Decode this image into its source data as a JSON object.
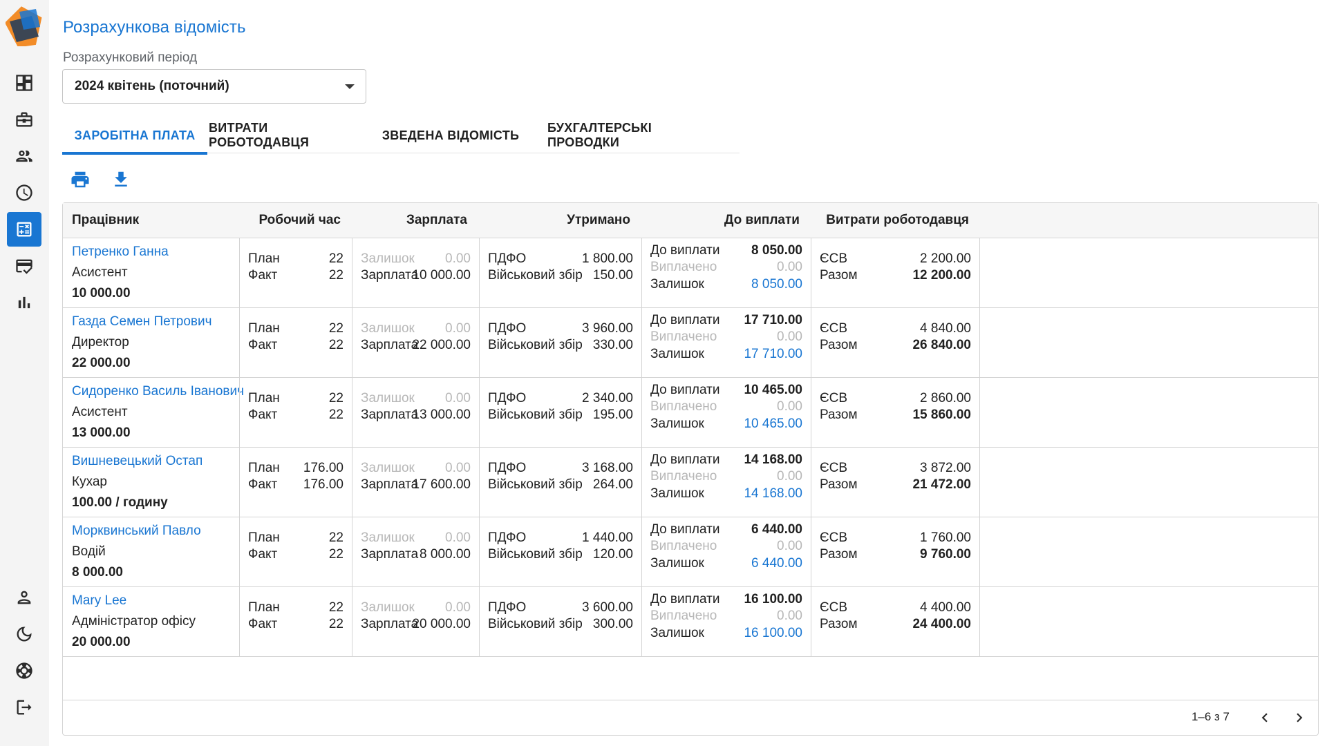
{
  "page": {
    "title": "Розрахункова відомість"
  },
  "period": {
    "label": "Розрахунковий період",
    "value": "2024 квітень (поточний)"
  },
  "sidebar": {
    "items": [
      {
        "icon": "dashboard-icon"
      },
      {
        "icon": "briefcase-icon"
      },
      {
        "icon": "people-icon"
      },
      {
        "icon": "clock-icon"
      },
      {
        "icon": "calculator-icon",
        "active": true
      },
      {
        "icon": "card-check-icon"
      },
      {
        "icon": "bar-chart-icon"
      }
    ],
    "bottom": [
      {
        "icon": "person-icon"
      },
      {
        "icon": "moon-icon"
      },
      {
        "icon": "support-icon"
      },
      {
        "icon": "logout-icon"
      }
    ]
  },
  "tabs": [
    {
      "label": "ЗАРОБІТНА ПЛАТА",
      "active": true
    },
    {
      "label": "ВИТРАТИ РОБОТОДАВЦЯ"
    },
    {
      "label": "ЗВЕДЕНА ВІДОМІСТЬ"
    },
    {
      "label": "БУХГАЛТЕРСЬКІ ПРОВОДКИ"
    }
  ],
  "toolbar": {
    "print_icon": "print-icon",
    "download_icon": "download-icon"
  },
  "table": {
    "headers": {
      "employee": "Працівник",
      "worktime": "Робочий час",
      "salary": "Зарплата",
      "withheld": "Утримано",
      "payout": "До виплати",
      "employer": "Витрати роботодавця"
    },
    "labels": {
      "plan": "План",
      "fact": "Факт",
      "balance": "Залишок",
      "salary": "Зарплата",
      "pdfo": "ПДФО",
      "military": "Військовий збір",
      "to_pay": "До виплати",
      "paid": "Виплачено",
      "remaining": "Залишок",
      "esv": "ЄСВ",
      "total": "Разом"
    },
    "rows": [
      {
        "name": "Петренко Ганна",
        "position": "Асистент",
        "rate": "10 000.00",
        "plan": "22",
        "fact": "22",
        "balance": "0.00",
        "salary": "10 000.00",
        "pdfo": "1 800.00",
        "military": "150.00",
        "to_pay": "8 050.00",
        "paid": "0.00",
        "remaining": "8 050.00",
        "esv": "2 200.00",
        "total": "12 200.00"
      },
      {
        "name": "Газда Семен Петрович",
        "position": "Директор",
        "rate": "22 000.00",
        "plan": "22",
        "fact": "22",
        "balance": "0.00",
        "salary": "22 000.00",
        "pdfo": "3 960.00",
        "military": "330.00",
        "to_pay": "17 710.00",
        "paid": "0.00",
        "remaining": "17 710.00",
        "esv": "4 840.00",
        "total": "26 840.00"
      },
      {
        "name": "Сидоренко Василь Іванович",
        "position": "Асистент",
        "rate": "13 000.00",
        "plan": "22",
        "fact": "22",
        "balance": "0.00",
        "salary": "13 000.00",
        "pdfo": "2 340.00",
        "military": "195.00",
        "to_pay": "10 465.00",
        "paid": "0.00",
        "remaining": "10 465.00",
        "esv": "2 860.00",
        "total": "15 860.00"
      },
      {
        "name": "Вишневецький Остап",
        "position": "Кухар",
        "rate": "100.00 / годину",
        "plan": "176.00",
        "fact": "176.00",
        "balance": "0.00",
        "salary": "17 600.00",
        "pdfo": "3 168.00",
        "military": "264.00",
        "to_pay": "14 168.00",
        "paid": "0.00",
        "remaining": "14 168.00",
        "esv": "3 872.00",
        "total": "21 472.00"
      },
      {
        "name": "Морквинський Павло",
        "position": "Водій",
        "rate": "8 000.00",
        "plan": "22",
        "fact": "22",
        "balance": "0.00",
        "salary": "8 000.00",
        "pdfo": "1 440.00",
        "military": "120.00",
        "to_pay": "6 440.00",
        "paid": "0.00",
        "remaining": "6 440.00",
        "esv": "1 760.00",
        "total": "9 760.00"
      },
      {
        "name": "Mary Lee",
        "position": "Адміністратор офісу",
        "rate": "20 000.00",
        "plan": "22",
        "fact": "22",
        "balance": "0.00",
        "salary": "20 000.00",
        "pdfo": "3 600.00",
        "military": "300.00",
        "to_pay": "16 100.00",
        "paid": "0.00",
        "remaining": "16 100.00",
        "esv": "4 400.00",
        "total": "24 400.00"
      }
    ]
  },
  "pagination": {
    "text": "1–6 з 7"
  },
  "colors": {
    "accent": "#1976d2",
    "muted": "#b7b7b7",
    "border": "#d4d4d4"
  }
}
